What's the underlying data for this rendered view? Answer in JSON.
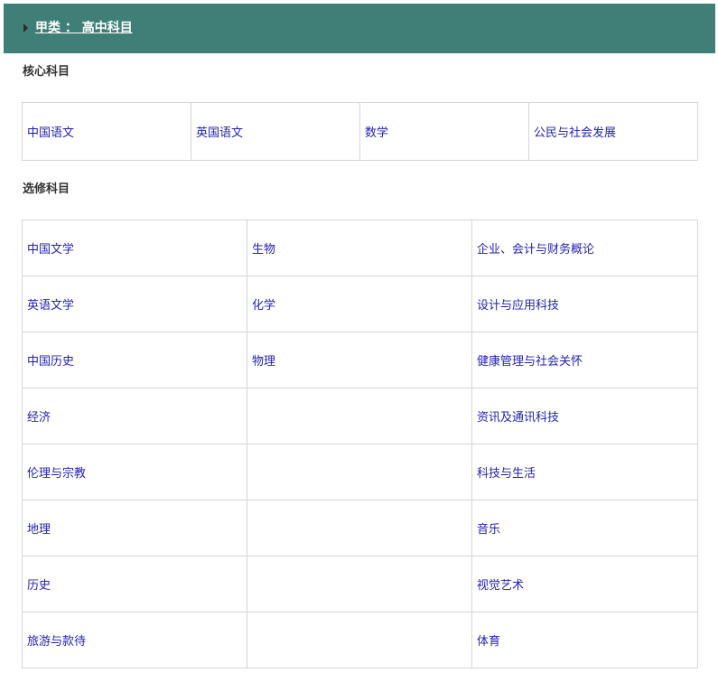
{
  "header": {
    "title": "甲类 ： 高中科目"
  },
  "core_section": {
    "title": "核心科目",
    "subjects": [
      "中国语文",
      "英国语文",
      "数学",
      "公民与社会发展"
    ]
  },
  "elective_section": {
    "title": "选修科目",
    "rows": [
      [
        "中国文学",
        "生物",
        "企业、会计与财务概论"
      ],
      [
        "英语文学",
        "化学",
        "设计与应用科技"
      ],
      [
        "中国历史",
        "物理",
        "健康管理与社会关怀"
      ],
      [
        "经济",
        "",
        "资讯及通讯科技"
      ],
      [
        "伦理与宗教",
        "",
        "科技与生活"
      ],
      [
        "地理",
        "",
        "音乐"
      ],
      [
        "历史",
        "",
        "视觉艺术"
      ],
      [
        "旅游与款待",
        "",
        "体育"
      ]
    ]
  },
  "colors": {
    "header_bg": "#3f7f78",
    "link": "#1f1fb3",
    "border": "#d6d6d6"
  }
}
